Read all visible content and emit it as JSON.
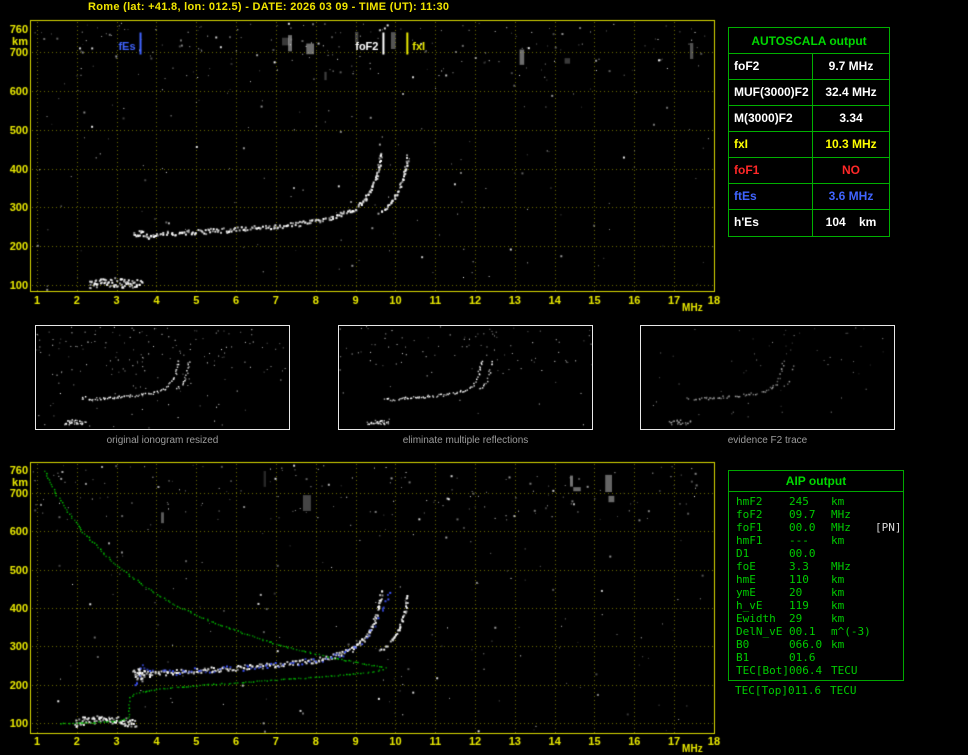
{
  "title": "Rome (lat: +41.8, lon: 012.5) - DATE: 2026 03 09 - TIME (UT): 11:30",
  "colors": {
    "axis_yellow": "#e8e800",
    "grid_olive": "#6c6c00",
    "frame_yellow": "#d8d800",
    "panel_green": "#00b000",
    "header_green": "#00d800",
    "text_green": "#00cc00",
    "caption_gray": "#9c9c9c",
    "trace_blue": "#3f55ff",
    "profile_green": "#00cc00",
    "marker_blue": "#4064ff",
    "alert_red": "#ff2828"
  },
  "autoscala": {
    "header": "AUTOSCALA output",
    "rows": [
      {
        "label": "foF2",
        "value": "9.7 MHz",
        "color": "#ffffff"
      },
      {
        "label": "MUF(3000)F2",
        "value": "32.4 MHz",
        "color": "#ffffff"
      },
      {
        "label": "M(3000)F2",
        "value": "3.34",
        "color": "#ffffff"
      },
      {
        "label": "fxI",
        "value": "10.3 MHz",
        "color": "#ffff00"
      },
      {
        "label": "foF1",
        "value": "NO",
        "color": "#ff2828"
      },
      {
        "label": "ftEs",
        "value": "3.6 MHz",
        "color": "#4064ff"
      },
      {
        "label": "h'Es",
        "value": "104    km",
        "color": "#ffffff"
      }
    ]
  },
  "thumbnails": {
    "captions": [
      "original ionogram resized",
      "eliminate multiple reflections",
      "evidence F2 trace"
    ]
  },
  "aip": {
    "header": "AIP output",
    "rows": [
      {
        "label": "hmF2",
        "value": "245",
        "unit": "km",
        "extra": ""
      },
      {
        "label": "foF2",
        "value": "09.7",
        "unit": "MHz",
        "extra": ""
      },
      {
        "label": "foF1",
        "value": "00.0",
        "unit": "MHz",
        "extra": "[PN]"
      },
      {
        "label": "hmF1",
        "value": "---",
        "unit": "km",
        "extra": ""
      },
      {
        "label": "D1",
        "value": "00.0",
        "unit": "",
        "extra": ""
      },
      {
        "label": "foE",
        "value": "3.3",
        "unit": "MHz",
        "extra": ""
      },
      {
        "label": "hmE",
        "value": "110",
        "unit": "km",
        "extra": ""
      },
      {
        "label": "ymE",
        "value": "20",
        "unit": "km",
        "extra": ""
      },
      {
        "label": "h_vE",
        "value": "119",
        "unit": "km",
        "extra": ""
      },
      {
        "label": "Ewidth",
        "value": "29",
        "unit": "km",
        "extra": ""
      },
      {
        "label": "DelN_vE",
        "value": "00.1",
        "unit": "m^(-3)",
        "extra": ""
      },
      {
        "label": "B0",
        "value": "066.0",
        "unit": "km",
        "extra": ""
      },
      {
        "label": "B1",
        "value": "01.6",
        "unit": "",
        "extra": ""
      },
      {
        "label": "TEC[Bot]",
        "value": "006.4",
        "unit": "TECU",
        "extra": ""
      }
    ],
    "outside_row": {
      "label": "TEC[Top]",
      "value": "011.6",
      "unit": "TECU",
      "extra": ""
    }
  },
  "chart_data": [
    {
      "type": "scatter",
      "name": "recorded ionogram",
      "xlabel": "MHz",
      "ylabel": "km",
      "xlim": [
        1,
        18
      ],
      "ylim": [
        100,
        760
      ],
      "grid": true,
      "x_ticks": [
        1,
        2,
        3,
        4,
        5,
        6,
        7,
        8,
        9,
        10,
        11,
        12,
        13,
        14,
        15,
        16,
        17,
        18
      ],
      "y_ticks": [
        760,
        700,
        600,
        500,
        400,
        300,
        200,
        100
      ],
      "markers": [
        {
          "label": "fEs",
          "mhz": 3.6,
          "color": "#4064ff",
          "side": "left"
        },
        {
          "label": "foF2",
          "mhz": 9.7,
          "color": "#ffffff",
          "side": "left"
        },
        {
          "label": "fxI",
          "mhz": 10.3,
          "color": "#e8e800",
          "side": "right"
        }
      ],
      "series": [
        {
          "name": "Es-layer-echo",
          "color": "#ffffff",
          "style": {
            "step": 1.8,
            "jitter": 9,
            "size": 2,
            "skip": 0.08,
            "passes": 3
          },
          "points": [
            [
              2.3,
              104
            ],
            [
              2.45,
              106
            ],
            [
              2.6,
              108
            ],
            [
              2.75,
              109
            ],
            [
              2.9,
              109
            ],
            [
              3.05,
              108
            ],
            [
              3.2,
              106
            ],
            [
              3.35,
              105
            ],
            [
              3.5,
              104
            ],
            [
              3.65,
              103
            ]
          ]
        },
        {
          "name": "F2-trace-ordinary",
          "color": "#ffffff",
          "style": {
            "step": 2.4,
            "jitter": 5,
            "size": 2,
            "skip": 0.05,
            "passes": 2
          },
          "points": [
            [
              3.42,
              236
            ],
            [
              3.5,
              230
            ],
            [
              3.58,
              240
            ],
            [
              3.68,
              233
            ],
            [
              3.8,
              228
            ],
            [
              3.95,
              231
            ],
            [
              4.15,
              233
            ],
            [
              4.35,
              234
            ],
            [
              4.6,
              236
            ],
            [
              4.85,
              238
            ],
            [
              5.1,
              239
            ],
            [
              5.35,
              241
            ],
            [
              5.6,
              242
            ],
            [
              5.85,
              244
            ],
            [
              6.1,
              246
            ],
            [
              6.35,
              248
            ],
            [
              6.6,
              250
            ],
            [
              6.85,
              252
            ],
            [
              7.1,
              254
            ],
            [
              7.35,
              257
            ],
            [
              7.6,
              260
            ],
            [
              7.85,
              263
            ],
            [
              8.1,
              268
            ],
            [
              8.3,
              273
            ],
            [
              8.5,
              279
            ],
            [
              8.7,
              286
            ],
            [
              8.88,
              294
            ],
            [
              9.03,
              304
            ],
            [
              9.16,
              316
            ],
            [
              9.27,
              330
            ],
            [
              9.36,
              346
            ],
            [
              9.44,
              363
            ],
            [
              9.5,
              381
            ],
            [
              9.55,
              399
            ],
            [
              9.59,
              417
            ],
            [
              9.62,
              433
            ],
            [
              9.64,
              447
            ]
          ]
        },
        {
          "name": "F2-trace-extraordinary",
          "color": "#ffffff",
          "style": {
            "step": 2.6,
            "jitter": 3,
            "size": 2,
            "skip": 0.15,
            "passes": 2
          },
          "points": [
            [
              9.58,
              288
            ],
            [
              9.7,
              297
            ],
            [
              9.82,
              308
            ],
            [
              9.93,
              321
            ],
            [
              10.02,
              336
            ],
            [
              10.1,
              353
            ],
            [
              10.16,
              371
            ],
            [
              10.21,
              390
            ],
            [
              10.25,
              408
            ],
            [
              10.28,
              425
            ],
            [
              10.3,
              441
            ]
          ]
        }
      ]
    },
    {
      "type": "scatter",
      "name": "autoscaled ionogram with restored profile",
      "xlabel": "MHz",
      "ylabel": "km",
      "xlim": [
        1,
        18
      ],
      "ylim": [
        100,
        760
      ],
      "grid": true,
      "x_ticks": [
        1,
        2,
        3,
        4,
        5,
        6,
        7,
        8,
        9,
        10,
        11,
        12,
        13,
        14,
        15,
        16,
        17,
        18
      ],
      "y_ticks": [
        760,
        700,
        600,
        500,
        400,
        300,
        200,
        100
      ],
      "series": [
        {
          "name": "Es-layer-echo",
          "color": "#ffffff",
          "style": {
            "step": 1.8,
            "jitter": 9,
            "size": 2,
            "skip": 0.08,
            "passes": 3
          },
          "points": [
            [
              1.95,
              103
            ],
            [
              2.15,
              106
            ],
            [
              2.35,
              108
            ],
            [
              2.55,
              110
            ],
            [
              2.75,
              110
            ],
            [
              2.95,
              108
            ],
            [
              3.15,
              106
            ],
            [
              3.35,
              104
            ],
            [
              3.5,
              103
            ]
          ]
        },
        {
          "name": "F2-trace-ordinary",
          "color": "#ffffff",
          "style": {
            "step": 2.4,
            "jitter": 5,
            "size": 2,
            "skip": 0.05,
            "passes": 2
          },
          "points": [
            [
              3.42,
              236
            ],
            [
              3.5,
              222
            ],
            [
              3.55,
              245
            ],
            [
              3.62,
              215
            ],
            [
              3.68,
              233
            ],
            [
              3.8,
              228
            ],
            [
              3.95,
              231
            ],
            [
              4.15,
              233
            ],
            [
              4.35,
              234
            ],
            [
              4.6,
              236
            ],
            [
              4.85,
              238
            ],
            [
              5.1,
              239
            ],
            [
              5.35,
              241
            ],
            [
              5.6,
              242
            ],
            [
              5.85,
              244
            ],
            [
              6.1,
              246
            ],
            [
              6.35,
              248
            ],
            [
              6.6,
              250
            ],
            [
              6.85,
              252
            ],
            [
              7.1,
              254
            ],
            [
              7.35,
              257
            ],
            [
              7.6,
              260
            ],
            [
              7.85,
              263
            ],
            [
              8.1,
              268
            ],
            [
              8.3,
              273
            ],
            [
              8.5,
              279
            ],
            [
              8.7,
              286
            ],
            [
              8.88,
              294
            ],
            [
              9.03,
              304
            ],
            [
              9.16,
              316
            ],
            [
              9.27,
              330
            ],
            [
              9.36,
              346
            ],
            [
              9.44,
              363
            ],
            [
              9.5,
              381
            ],
            [
              9.55,
              399
            ],
            [
              9.59,
              417
            ],
            [
              9.62,
              433
            ],
            [
              9.64,
              447
            ]
          ]
        },
        {
          "name": "F2-trace-extraordinary",
          "color": "#ffffff",
          "style": {
            "step": 2.6,
            "jitter": 3,
            "size": 2,
            "skip": 0.15,
            "passes": 2
          },
          "points": [
            [
              9.58,
              288
            ],
            [
              9.7,
              297
            ],
            [
              9.82,
              308
            ],
            [
              9.93,
              321
            ],
            [
              10.02,
              336
            ],
            [
              10.1,
              353
            ],
            [
              10.16,
              371
            ],
            [
              10.21,
              390
            ],
            [
              10.25,
              408
            ],
            [
              10.28,
              425
            ],
            [
              10.3,
              441
            ]
          ]
        },
        {
          "name": "electron-density-profile",
          "color": "#00cc00",
          "style": {
            "step": 2.6,
            "jitter": 1,
            "size": 1.5,
            "skip": 0,
            "passes": 1
          },
          "points": [
            [
              1.2,
              758
            ],
            [
              1.32,
              730
            ],
            [
              1.46,
              700
            ],
            [
              1.63,
              670
            ],
            [
              1.83,
              640
            ],
            [
              2.06,
              610
            ],
            [
              2.32,
              580
            ],
            [
              2.6,
              550
            ],
            [
              2.92,
              520
            ],
            [
              3.27,
              490
            ],
            [
              3.66,
              460
            ],
            [
              4.1,
              430
            ],
            [
              4.58,
              403
            ],
            [
              5.12,
              377
            ],
            [
              5.72,
              352
            ],
            [
              6.38,
              328
            ],
            [
              7.05,
              306
            ],
            [
              7.75,
              287
            ],
            [
              8.45,
              271
            ],
            [
              9.0,
              260
            ],
            [
              9.4,
              252
            ],
            [
              9.65,
              247
            ],
            [
              9.72,
              245
            ],
            [
              9.6,
              239
            ],
            [
              9.2,
              232
            ],
            [
              8.55,
              226
            ],
            [
              7.75,
              219
            ],
            [
              6.9,
              213
            ],
            [
              6.05,
              207
            ],
            [
              5.25,
              201
            ],
            [
              4.55,
              195
            ],
            [
              4.0,
              189
            ],
            [
              3.62,
              183
            ],
            [
              3.42,
              176
            ],
            [
              3.33,
              168
            ],
            [
              3.3,
              159
            ],
            [
              3.3,
              150
            ],
            [
              3.3,
              141
            ],
            [
              3.3,
              133
            ],
            [
              3.3,
              125
            ],
            [
              3.28,
              117
            ],
            [
              3.2,
              111
            ],
            [
              2.9,
              106
            ],
            [
              2.45,
              103
            ],
            [
              1.95,
              101
            ],
            [
              1.5,
              100
            ]
          ]
        },
        {
          "name": "restored-trace",
          "color": "#3f55ff",
          "style": {
            "step": 3.2,
            "jitter": 6,
            "size": 2,
            "skip": 0.22,
            "passes": 1
          },
          "points": [
            [
              3.48,
              196
            ],
            [
              3.5,
              210
            ],
            [
              3.53,
              224
            ],
            [
              3.57,
              238
            ],
            [
              3.62,
              248
            ],
            [
              3.9,
              232
            ],
            [
              4.3,
              234
            ],
            [
              4.7,
              237
            ],
            [
              5.1,
              239
            ],
            [
              5.5,
              242
            ],
            [
              5.9,
              244
            ],
            [
              6.3,
              247
            ],
            [
              6.7,
              251
            ],
            [
              7.1,
              254
            ],
            [
              7.5,
              258
            ],
            [
              7.9,
              264
            ],
            [
              8.3,
              272
            ],
            [
              8.65,
              283
            ],
            [
              8.95,
              298
            ],
            [
              9.2,
              316
            ],
            [
              9.38,
              338
            ],
            [
              9.5,
              362
            ],
            [
              9.6,
              388
            ],
            [
              9.7,
              408
            ],
            [
              9.78,
              424
            ],
            [
              9.84,
              438
            ],
            [
              9.88,
              452
            ],
            [
              9.9,
              462
            ]
          ]
        }
      ]
    }
  ]
}
